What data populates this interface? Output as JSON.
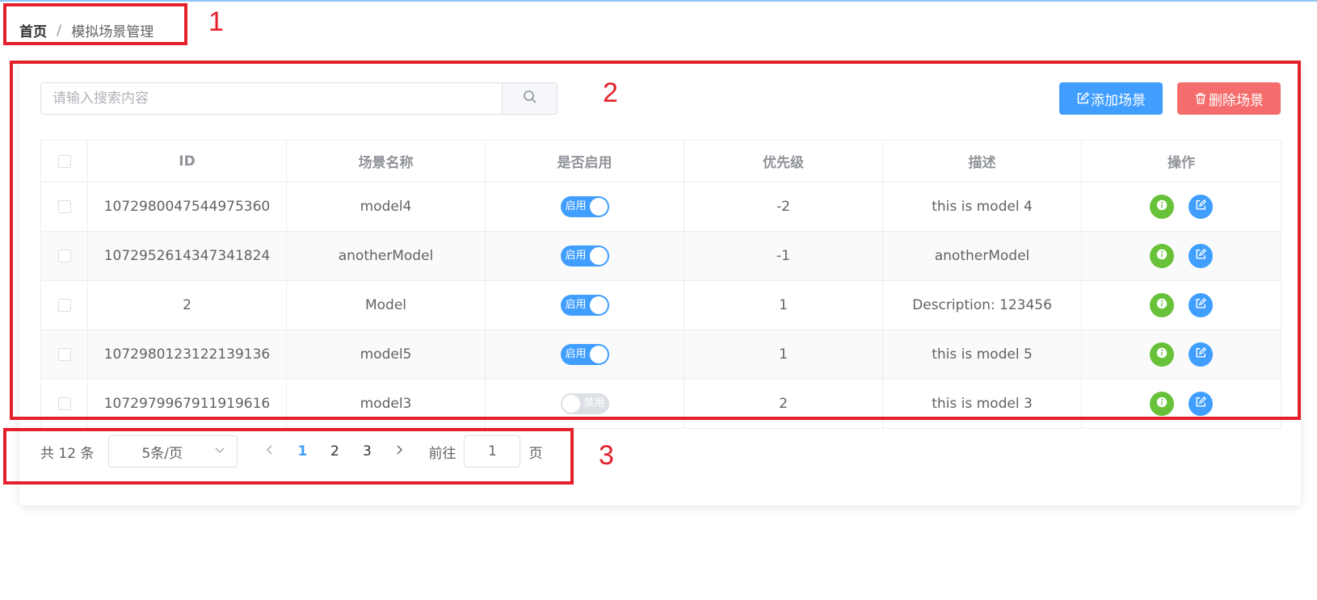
{
  "breadcrumb": {
    "home": "首页",
    "separator": "/",
    "current": "模拟场景管理"
  },
  "search": {
    "placeholder": "请输入搜索内容",
    "value": "",
    "icon": "search-icon"
  },
  "toolbar": {
    "add_label": "添加场景",
    "add_icon": "edit-icon",
    "delete_label": "删除场景",
    "delete_icon": "trash-icon"
  },
  "table": {
    "columns": [
      "ID",
      "场景名称",
      "是否启用",
      "优先级",
      "描述",
      "操作"
    ],
    "rows": [
      {
        "id": "1072980047544975360",
        "name": "model4",
        "enabled": true,
        "switch_label": "启用",
        "priority": "-2",
        "description": "this is model 4"
      },
      {
        "id": "1072952614347341824",
        "name": "anotherModel",
        "enabled": true,
        "switch_label": "启用",
        "priority": "-1",
        "description": "anotherModel"
      },
      {
        "id": "2",
        "name": "Model",
        "enabled": true,
        "switch_label": "启用",
        "priority": "1",
        "description": "Description: 123456"
      },
      {
        "id": "1072980123122139136",
        "name": "model5",
        "enabled": true,
        "switch_label": "启用",
        "priority": "1",
        "description": "this is model 5"
      },
      {
        "id": "1072979967911919616",
        "name": "model3",
        "enabled": false,
        "switch_label": "禁用",
        "priority": "2",
        "description": "this is model 3"
      }
    ],
    "row_actions": [
      "info-icon",
      "edit-icon"
    ]
  },
  "pagination": {
    "total_text": "共 12 条",
    "page_size": "5条/页",
    "pages": [
      "1",
      "2",
      "3"
    ],
    "current_page": "1",
    "goto_label": "前往",
    "goto_value": "1",
    "page_suffix": "页"
  },
  "annotations": [
    "1",
    "2",
    "3"
  ],
  "colors": {
    "primary": "#409eff",
    "danger": "#f56c6c",
    "success": "#67c23a",
    "annotation": "#e3202b"
  }
}
